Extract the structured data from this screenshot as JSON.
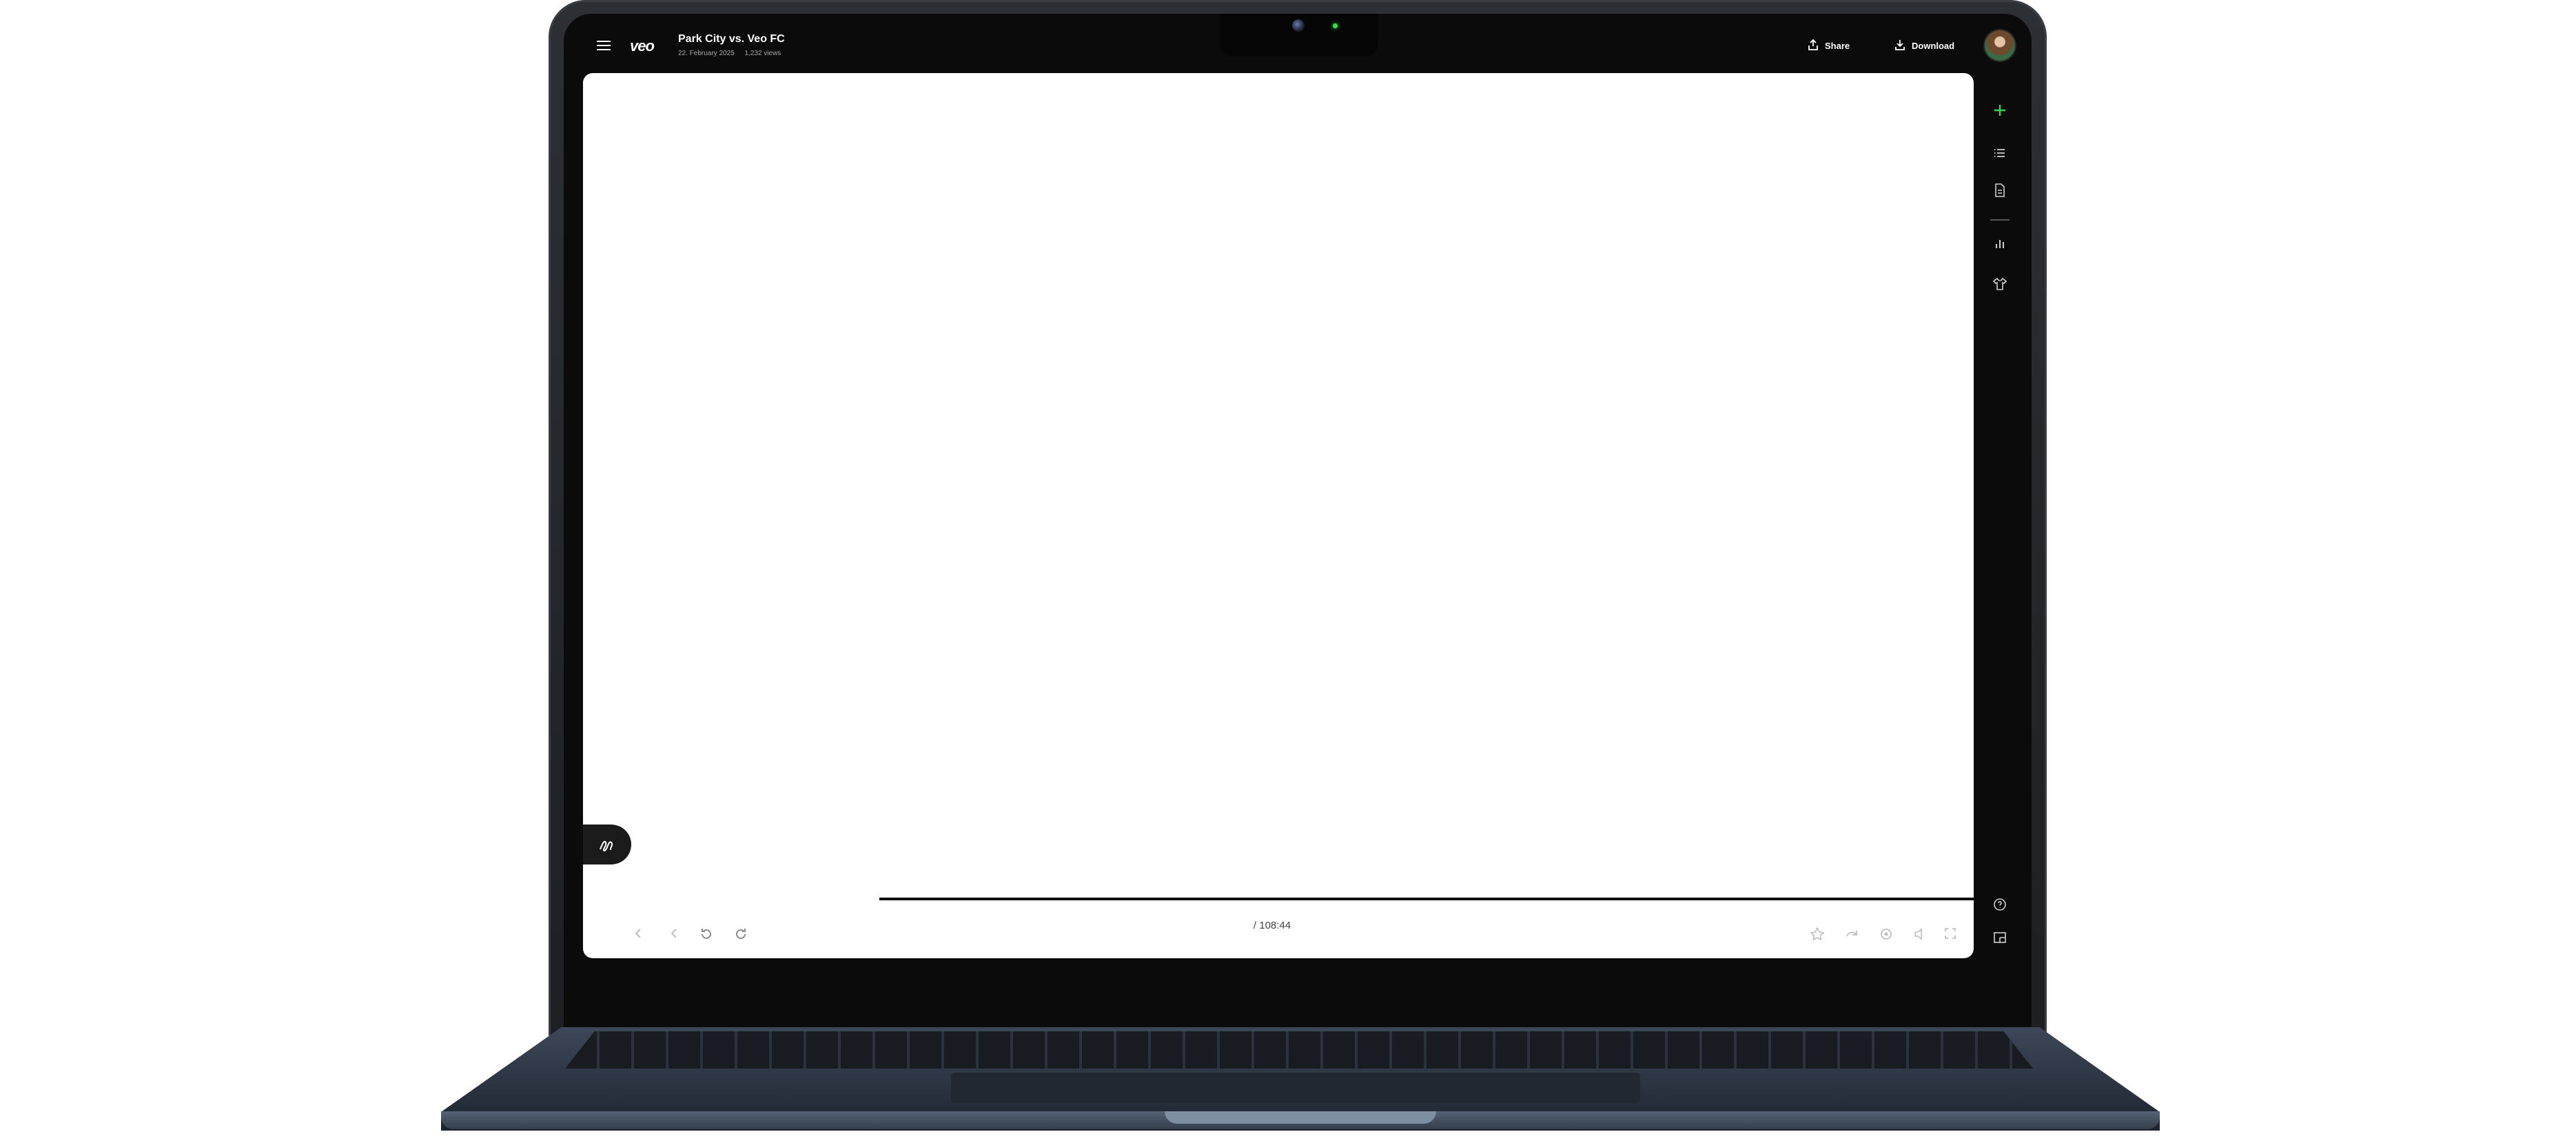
{
  "match": {
    "title": "Park City vs. Veo FC",
    "date": "22. February 2025",
    "views": "1,232 views"
  },
  "brand": {
    "logo": "veo"
  },
  "header": {
    "share_label": "Share",
    "download_label": "Download"
  },
  "player": {
    "time_display": "/ 108:44"
  },
  "icons": {
    "menu": "menu-icon",
    "share": "share-icon",
    "download": "download-icon",
    "add": "plus-icon",
    "list": "list-icon",
    "document": "document-icon",
    "stats": "bar-chart-icon",
    "lineup": "jersey-icon",
    "help": "help-icon",
    "layout": "layout-icon",
    "draw": "draw-icon"
  },
  "colors": {
    "accent": "#3fd14f",
    "background": "#0b0b0c",
    "text": "#ffffff",
    "muted": "#a8a8a8"
  }
}
